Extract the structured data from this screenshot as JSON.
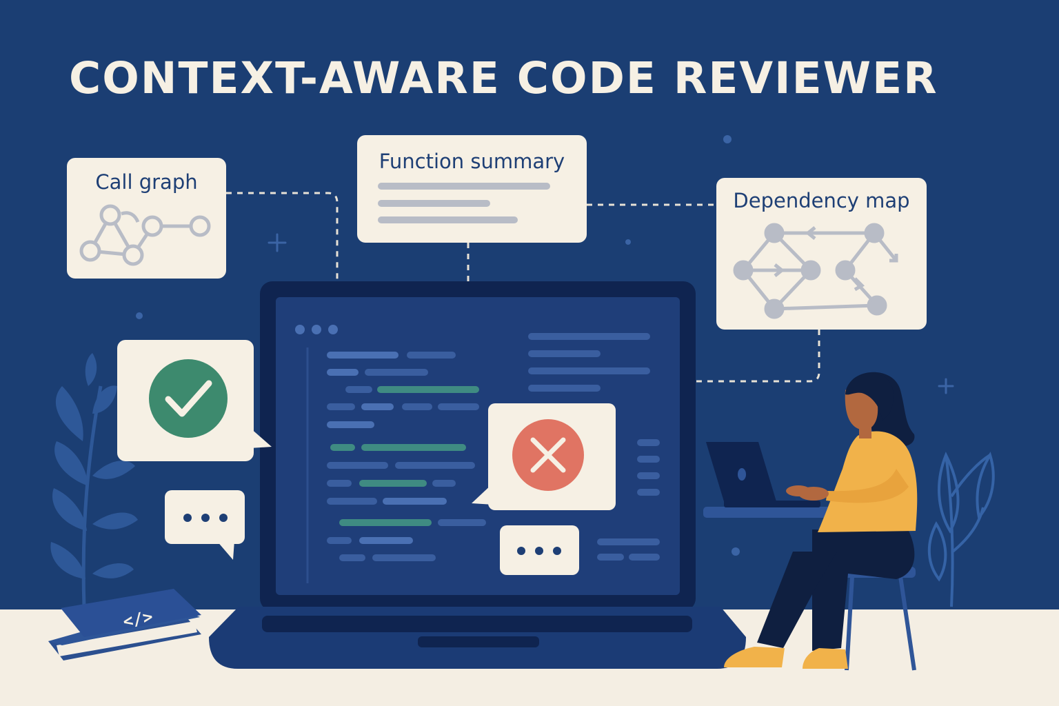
{
  "title": "CONTEXT-AWARE CODE REVIEWER",
  "cards": {
    "call_graph": "Call graph",
    "function_summary": "Function summary",
    "dependency_map": "Dependency map"
  },
  "book": {
    "glyph": "</>"
  },
  "comments": {
    "typing_indicator": "•••"
  },
  "icons": [
    "check-icon",
    "cross-icon",
    "typing-dots-icon",
    "code-book-icon",
    "call-graph-icon",
    "dependency-graph-icon",
    "plant-icon",
    "plus-sparkle-icon"
  ],
  "colors": {
    "background": "#1B3E73",
    "floor": "#F4EEE3",
    "card": "#F6F0E4",
    "accent_text": "#1E3F75",
    "approve": "#3D8A6E",
    "reject": "#E07463",
    "sweater": "#F1B24A"
  }
}
